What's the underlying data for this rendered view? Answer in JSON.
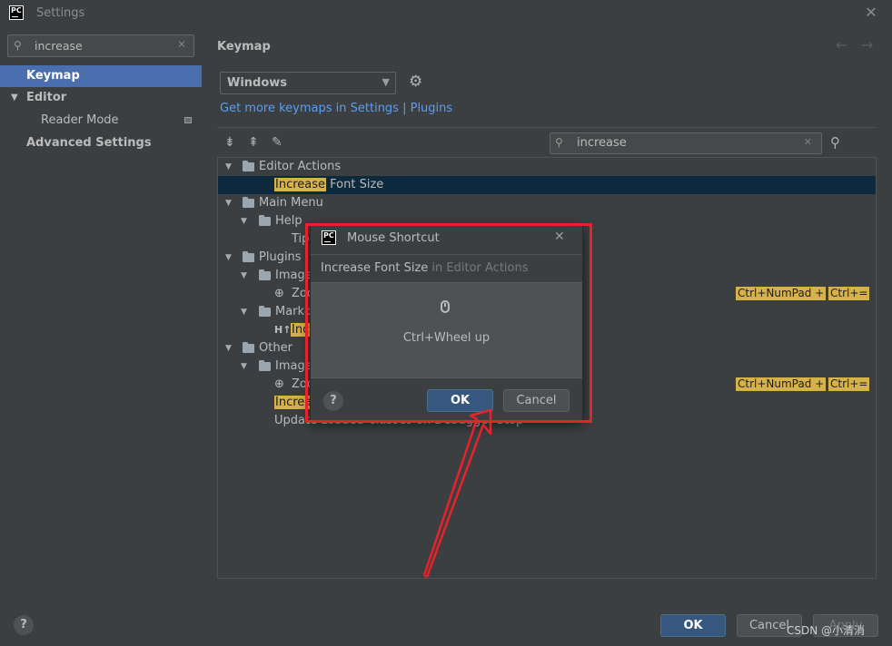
{
  "window": {
    "title": "Settings",
    "logo": "PC"
  },
  "sidebar": {
    "search": {
      "value": "increase"
    },
    "items": [
      {
        "label": "Keymap"
      },
      {
        "label": "Editor"
      },
      {
        "label": "Reader Mode"
      },
      {
        "label": "Advanced Settings"
      }
    ]
  },
  "main": {
    "title": "Keymap",
    "keymap_select": {
      "value": "Windows"
    },
    "link_text": "Get more keymaps in Settings | Plugins",
    "search": {
      "value": "increase"
    },
    "tree": {
      "editor_actions": "Editor Actions",
      "increase_hl": "Increase",
      "increase_rest": " Font Size",
      "main_menu": "Main Menu",
      "help": "Help",
      "tip": "Tip",
      "plugins": "Plugins",
      "image": "Image",
      "zoom": "Zoo",
      "markd": "Markd",
      "ht_prefix": "H↑",
      "ht_hl": "Inc",
      "other": "Other",
      "increa_hl": "Increa",
      "update_row": "Update Loaded Classes on Debugger Stop",
      "sc_numpad": "Ctrl+NumPad +",
      "sc_equals": "Ctrl+="
    }
  },
  "footer": {
    "ok_label": "OK",
    "cancel_label": "Cancel",
    "apply_label": "Apply",
    "help_label": "?"
  },
  "watermark": "CSDN @小清消",
  "modal": {
    "title": "Mouse Shortcut",
    "logo": "PC",
    "action_name": "Increase Font Size",
    "action_context": " in Editor Actions",
    "capture_text": "Ctrl+Wheel up",
    "ok_label": "OK",
    "cancel_label": "Cancel",
    "help_label": "?"
  },
  "colors": {
    "accent": "#4b6eaf",
    "highlight": "#d6b24a",
    "annotation": "#e8222b",
    "link": "#589df6"
  }
}
